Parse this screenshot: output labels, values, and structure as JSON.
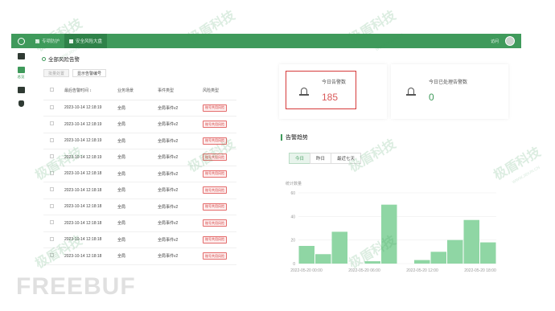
{
  "topbar": {
    "nav": [
      {
        "label": "专项防护",
        "active": false
      },
      {
        "label": "安全风险大盘",
        "active": true
      }
    ],
    "user_label": "访问"
  },
  "sidebar": {
    "items": [
      {
        "icon": "monitor-icon",
        "label": "",
        "active": false
      },
      {
        "icon": "dashboard-icon",
        "label": "总览",
        "active": true
      },
      {
        "icon": "list-icon",
        "label": "",
        "active": false
      },
      {
        "icon": "shield-icon",
        "label": "",
        "active": false
      }
    ]
  },
  "left_panel": {
    "title": "全部风险告警",
    "buttons": [
      {
        "label": "批量处置",
        "disabled": true
      },
      {
        "label": "显示告警编号",
        "disabled": false
      }
    ],
    "columns": [
      "最后告警时间 ↕",
      "业务场景",
      "事件类型",
      "风险类型"
    ],
    "rows": [
      {
        "time": "2023-10-14 12:18:19",
        "scene": "全局",
        "event": "全局事件v2",
        "risk": "账号共用风险"
      },
      {
        "time": "2023-10-14 12:18:19",
        "scene": "全局",
        "event": "全局事件v2",
        "risk": "账号共用风险"
      },
      {
        "time": "2023-10-14 12:18:19",
        "scene": "全局",
        "event": "全局事件v2",
        "risk": "账号共用风险"
      },
      {
        "time": "2023-10-14 12:18:19",
        "scene": "全局",
        "event": "全局事件v2",
        "risk": "账号共用风险"
      },
      {
        "time": "2023-10-14 12:18:18",
        "scene": "全局",
        "event": "全局事件v2",
        "risk": "账号共用风险"
      },
      {
        "time": "2023-10-14 12:18:18",
        "scene": "全局",
        "event": "全局事件v2",
        "risk": "账号共用风险"
      },
      {
        "time": "2023-10-14 12:18:18",
        "scene": "全局",
        "event": "全局事件v2",
        "risk": "账号共用风险"
      },
      {
        "time": "2023-10-14 12:18:18",
        "scene": "全局",
        "event": "全局事件v2",
        "risk": "账号共用风险"
      },
      {
        "time": "2023-10-14 12:18:18",
        "scene": "全局",
        "event": "全局事件v2",
        "risk": "账号共用风险"
      },
      {
        "time": "2023-10-14 12:18:18",
        "scene": "全局",
        "event": "全局事件v2",
        "risk": "账号共用风险"
      }
    ]
  },
  "stats": {
    "today_alerts": {
      "label": "今日告警数",
      "value": "185",
      "color": "#d95a5a"
    },
    "today_handled": {
      "label": "今日已处理告警数",
      "value": "0",
      "color": "#3f9a5b"
    }
  },
  "trend": {
    "title": "告警趋势",
    "tabs": [
      {
        "label": "今日",
        "active": true
      },
      {
        "label": "昨日",
        "active": false
      },
      {
        "label": "最近七天",
        "active": false
      }
    ]
  },
  "chart_data": {
    "type": "bar",
    "ylabel": "统计数量",
    "ylim": [
      0,
      60
    ],
    "yticks": [
      0,
      20,
      40,
      60
    ],
    "x_labels_shown": [
      "2022-05-20 00:00",
      "2022-05-20 06:00",
      "2022-05-20 12:00",
      "2022-05-20 18:00"
    ],
    "values": [
      15,
      8,
      27,
      0,
      2,
      50,
      0,
      3,
      10,
      20,
      37,
      18
    ],
    "bar_color": "#8fd6a4"
  },
  "watermark": {
    "text": "极盾科技",
    "sub": "WWW.JIDUN.CN",
    "brand": "FREEBUF"
  }
}
